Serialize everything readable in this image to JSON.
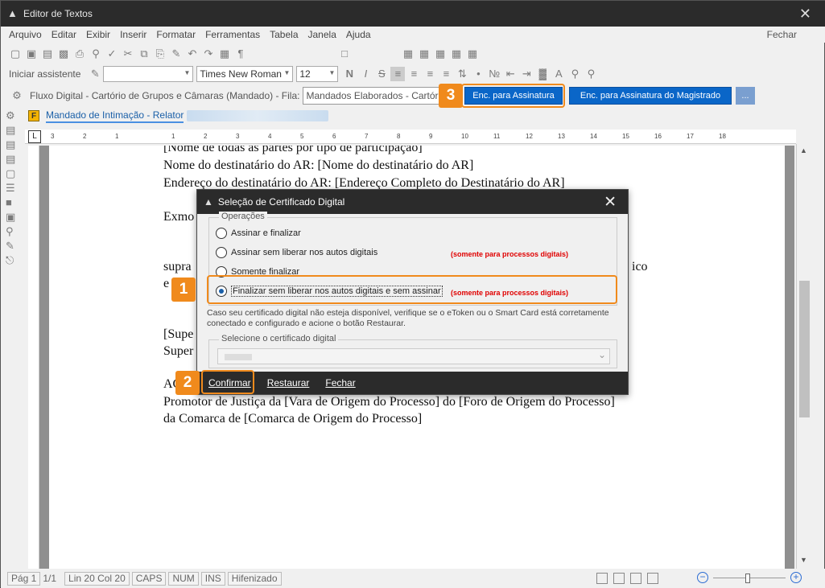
{
  "window": {
    "title": "Editor de Textos"
  },
  "menu": [
    "Arquivo",
    "Editar",
    "Exibir",
    "Inserir",
    "Formatar",
    "Ferramentas",
    "Tabela",
    "Janela",
    "Ajuda"
  ],
  "menu_close": "Fechar",
  "toolbar2": {
    "assistant": "Iniciar assistente",
    "font": "Times New Roman",
    "size": "12",
    "bold": "N",
    "italic": "I",
    "strike": "S"
  },
  "toolbar3": {
    "flow": "Fluxo Digital - Cartório de Grupos e Câmaras (Mandado) - Fila:",
    "queue": "Mandados Elaborados - Cartório",
    "enc_assinatura": "Enc. para Assinatura",
    "enc_magistrado": "Enc. para Assinatura do Magistrado",
    "more": "..."
  },
  "doc_tab": {
    "icon": "F",
    "label": "Mandado de Intimação - Relator"
  },
  "badges": {
    "one": "1",
    "two": "2",
    "three": "3"
  },
  "document": {
    "lines": [
      "[Nome de todas as partes por tipo de participação]",
      "Nome do destinatário do AR: [Nome do destinatário do AR]",
      "Endereço do destinatário do AR: [Endereço Completo do Destinatário do AR]",
      "Exmo",
      "supra",
      "ico",
      "e",
      "[Supe",
      "Super",
      "AC",
      "Promotor de Justiça da [Vara de Origem do Processo] do [Foro de Origem do Processo]",
      "da Comarca de [Comarca de Origem do Processo]"
    ]
  },
  "dialog": {
    "title": "Seleção de Certificado Digital",
    "group_label": "Operações",
    "options": [
      "Assinar e finalizar",
      "Assinar sem liberar nos autos digitais",
      "Somente finalizar",
      "Finalizar sem liberar nos autos digitais e sem assinar"
    ],
    "note": "(somente para processos digitais)",
    "info": "Caso seu certificado digital não esteja disponível, verifique se o eToken ou o Smart Card está corretamente conectado e configurado e acione o botão Restaurar.",
    "cert_label": "Selecione o certificado digital",
    "buttons": {
      "confirm": "Confirmar",
      "restore": "Restaurar",
      "close": "Fechar"
    }
  },
  "status": {
    "page": "Pág 1",
    "pages": "1/1",
    "position": "Lin 20  Col 20",
    "caps": "CAPS",
    "num": "NUM",
    "ins": "INS",
    "hyph": "Hifenizado"
  },
  "ruler": [
    "3",
    "2",
    "1",
    "1",
    "2",
    "3",
    "4",
    "5",
    "6",
    "7",
    "8",
    "9",
    "10",
    "11",
    "12",
    "13",
    "14",
    "15",
    "16",
    "17",
    "18"
  ]
}
